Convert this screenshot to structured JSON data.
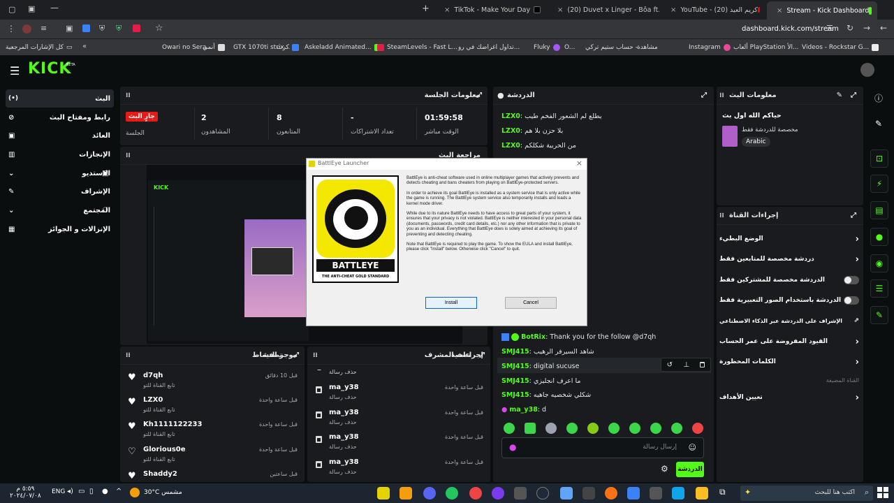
{
  "browser": {
    "tabs": [
      {
        "title": "Stream - Kick Dashboard",
        "active": true
      },
      {
        "title": "YouTube - كريم العيد (20)",
        "active": false
      },
      {
        "title": "(20) Duvet x Linger - Bôa ft. The",
        "active": false
      },
      {
        "title": "TikTok - Make Your Day",
        "active": false
      }
    ],
    "url": "dashboard.kick.com/stream",
    "bookmarks": [
      "كل الإشارات المرجعية",
      "Owari no Sera...",
      "أنمي",
      "GTX 1070ti strix...",
      "كرت",
      "Askeladd Animated...",
      "SteamLevels - Fast L...",
      "تداول اغراضك في رو...",
      "Fluky",
      "O...",
      "حساب ستيم تركي -",
      "مشاهدة",
      "Instagram",
      "ألعاب PlayStation الأ...",
      "Videos - Rockstar G..."
    ]
  },
  "kick": {
    "logo": "KICK",
    "beta": "BETA",
    "sidebar": [
      {
        "label": "البث",
        "icon": "broadcast-icon"
      },
      {
        "label": "رابط ومفتاح البث",
        "icon": "link-icon"
      },
      {
        "label": "العائد",
        "icon": "wallet-icon"
      },
      {
        "label": "الإنجازات",
        "icon": "trophy-icon"
      },
      {
        "label": "الاستديو",
        "icon": "studio-icon"
      },
      {
        "label": "الإشراف",
        "icon": "wrench-icon"
      },
      {
        "label": "المجتمع",
        "icon": "community-icon"
      },
      {
        "label": "الإنزالات و الجوائز",
        "icon": "gift-icon"
      }
    ]
  },
  "session": {
    "title": "معلومات الجلسة",
    "live_badge": "جارٍ البث",
    "stats": [
      {
        "label": "الجلسة",
        "value": ""
      },
      {
        "label": "المشاهدون",
        "value": "2"
      },
      {
        "label": "المتابعون",
        "value": "8"
      },
      {
        "label": "تعداد الاشتراكات",
        "value": "-"
      },
      {
        "label": "الوقت مباشر",
        "value": "01:59:58"
      }
    ]
  },
  "preview": {
    "title": "مراجعة البث"
  },
  "activity": {
    "title": "موجز النشاط",
    "filter": "تصفية",
    "items": [
      {
        "user": "d7qh",
        "sub": "تابع القناة للتو",
        "time": "قبل 10 دقائق"
      },
      {
        "user": "LZX0",
        "sub": "تابع القناة للتو",
        "time": "قبل ساعة واحدة"
      },
      {
        "user": "Kh1111122233",
        "sub": "تابع القناة للتو",
        "time": "قبل ساعة واحدة"
      },
      {
        "user": "Glorious0e",
        "sub": "تابع القناة للتو",
        "time": "قبل ساعة واحدة"
      },
      {
        "user": "Shaddy2",
        "sub": "",
        "time": "قبل ساعتين"
      }
    ]
  },
  "modactions": {
    "title": "إجراءات المشرف",
    "filter": "تصفية",
    "first": "حذف رسالة",
    "items": [
      {
        "user": "ma_y38",
        "sub": "حذف رسالة",
        "time": "قبل ساعة واحدة"
      },
      {
        "user": "ma_y38",
        "sub": "حذف رسالة",
        "time": "قبل ساعة واحدة"
      },
      {
        "user": "ma_y38",
        "sub": "حذف رسالة",
        "time": "قبل ساعة واحدة"
      },
      {
        "user": "ma_y38",
        "sub": "حذف رسالة",
        "time": "قبل ساعة واحدة"
      }
    ]
  },
  "chat": {
    "title": "الدردشة",
    "top_lines": [
      {
        "user": "LZX0",
        "text": "يطلع لم الشعور الفخم طيب"
      },
      {
        "user": "LZX0",
        "text": "بلا حزن بلا هم"
      },
      {
        "user": "LZX0",
        "text": "من الحربية شكلكم"
      }
    ],
    "bottom_lines": [
      {
        "user": "BotRix",
        "text": "Thank you for the follow @d7qh"
      },
      {
        "user": "SMJ415",
        "text": "شاهد السيرفر الرهيب"
      },
      {
        "user": "SMJ415",
        "text": "digital sucuse"
      },
      {
        "user": "SMJ415",
        "text": "ما اعرف انجليزي"
      },
      {
        "user": "SMJ415",
        "text": "شكلي شخصيه جاهيه"
      },
      {
        "user": "ma_y38",
        "text": "d"
      }
    ],
    "input_placeholder": "إرسال رسالة",
    "send_label": "الدردشة"
  },
  "streaminfo": {
    "title": "معلومات البث",
    "stream_title": "حياكم الله اول بث",
    "category": "مخصصة للدردشة فقط",
    "tag": "Arabic"
  },
  "channelactions": {
    "title": "إجراءات القناة",
    "items": [
      {
        "label": "الوضع البطيء",
        "control": "arrow"
      },
      {
        "label": "دردشة مخصصة للمتابعين فقط",
        "control": "arrow"
      },
      {
        "label": "الدردشة مخصصة للمشتركين فقط",
        "control": "toggle"
      },
      {
        "label": "الدردشة باستخدام الصور التعبيرية فقط",
        "control": "toggle"
      },
      {
        "label": "الإشراف على الدردشة عبر الذكاء الاصطناعي",
        "control": "external"
      },
      {
        "label": "القيود المفروضة على عمر الحساب",
        "control": "arrow"
      },
      {
        "label": "الكلمات المحظورة",
        "control": "arrow"
      },
      {
        "label": "القناة المضيفة",
        "control": "none"
      },
      {
        "label": "تعيين الأهداف",
        "control": "arrow"
      }
    ]
  },
  "dialog": {
    "title": "BattlEye Launcher",
    "logo_text": "BATTLEYE",
    "logo_sub": "THE ANTI-CHEAT GOLD STANDARD",
    "p1": "BattlEye is anti-cheat software used in online multiplayer games that actively prevents and detects cheating and bans cheaters from playing on BattlEye-protected servers.",
    "p2": "In order to achieve its goal BattlEye is installed as a system service that is only active while the game is running. The BattlEye system service also temporarily installs and loads a kernel mode driver.",
    "p3": "While due to its nature BattlEye needs to have access to great parts of your system, it ensures that your privacy is not violated. BattlEye is neither interested in your personal data (documents, passwords, credit card details, etc.) nor any other information that is private to you as an individual. Everything that BattlEye does is solely aimed at achieving its goal of preventing and detecting cheating.",
    "p4": "Note that BattlEye is required to play the game. To show the EULA and install BattlEye, please click \"Install\" below. Otherwise click \"Cancel\" to quit.",
    "install": "Install",
    "cancel": "Cancel"
  },
  "taskbar": {
    "search": "اكتب هنا للبحث",
    "weather": "30°C مشمس",
    "lang": "ENG",
    "time": "٥:٥٩ م",
    "date": "٢٠٢٤/٠٧/٠٨"
  },
  "colors": {
    "accent": "#53fc18",
    "live": "#e91916",
    "panel": "#191b1f"
  }
}
